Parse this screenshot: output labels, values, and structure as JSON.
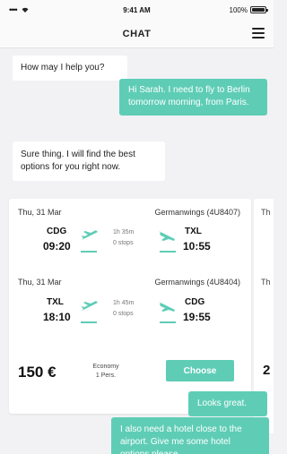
{
  "status_bar": {
    "signal": "•••• ",
    "time": "9:41 AM",
    "battery": "100%"
  },
  "nav": {
    "title": "CHAT"
  },
  "messages": [
    {
      "from": "bot",
      "text": "How may I help you?"
    },
    {
      "from": "user",
      "text": "Hi Sarah. I need to fly to Berlin tomorrow morning, from Paris."
    },
    {
      "from": "bot",
      "text": "Sure thing. I will find the best options for you right now."
    },
    {
      "from": "user",
      "text": "Looks great."
    },
    {
      "from": "user",
      "text": "I also need a hotel close to the airport. Give me some hotel options please."
    }
  ],
  "flight_card": {
    "outbound": {
      "date": "Thu, 31 Mar",
      "airline": "Germanwings (4U8407)",
      "from_code": "CDG",
      "from_time": "09:20",
      "duration": "1h 35m",
      "stops": "0 stops",
      "to_code": "TXL",
      "to_time": "10:55"
    },
    "return": {
      "date": "Thu, 31 Mar",
      "airline": "Germanwings (4U8404)",
      "from_code": "TXL",
      "from_time": "18:10",
      "duration": "1h 45m",
      "stops": "0 stops",
      "to_code": "CDG",
      "to_time": "19:55"
    },
    "price": "150 €",
    "fare_class": "Economy",
    "passengers": "1 Pers.",
    "choose_label": "Choose"
  },
  "next_card_peek": {
    "date_1": "Th",
    "date_2": "Th",
    "price": "2"
  },
  "colors": {
    "accent": "#5fcdb6",
    "bot_bubble": "#ffffff",
    "background": "#f2f2f4"
  },
  "icons": {
    "menu": "hamburger-menu-icon",
    "takeoff": "plane-takeoff-icon",
    "landing": "plane-landing-icon"
  }
}
